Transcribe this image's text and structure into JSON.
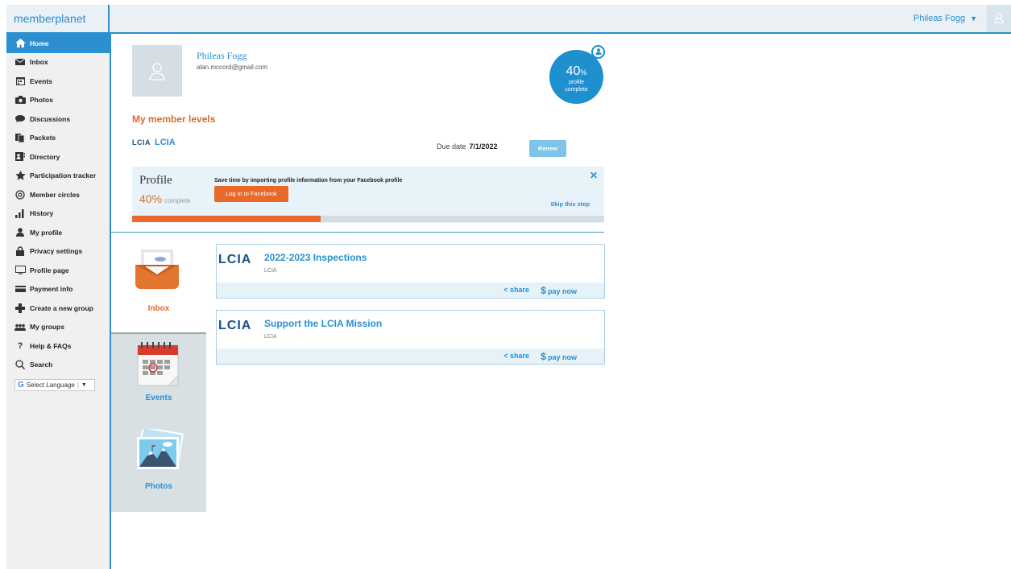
{
  "app": {
    "logo": "memberplanet"
  },
  "header": {
    "user_name": "Phileas Fogg"
  },
  "sidebar": {
    "items": [
      {
        "label": "Home",
        "icon": "home-icon",
        "active": true
      },
      {
        "label": "Inbox",
        "icon": "envelope-icon"
      },
      {
        "label": "Events",
        "icon": "calendar-icon"
      },
      {
        "label": "Photos",
        "icon": "camera-icon"
      },
      {
        "label": "Discussions",
        "icon": "speech-bubble-icon"
      },
      {
        "label": "Packets",
        "icon": "packets-icon"
      },
      {
        "label": "Directory",
        "icon": "directory-icon"
      },
      {
        "label": "Participation tracker",
        "icon": "star-icon"
      },
      {
        "label": "Member circles",
        "icon": "circles-icon"
      },
      {
        "label": "History",
        "icon": "bar-chart-icon"
      },
      {
        "label": "My profile",
        "icon": "person-icon"
      },
      {
        "label": "Privacy settings",
        "icon": "lock-icon"
      },
      {
        "label": "Profile page",
        "icon": "monitor-icon"
      },
      {
        "label": "Payment info",
        "icon": "credit-card-icon"
      },
      {
        "label": "Create a new group",
        "icon": "add-group-icon"
      },
      {
        "label": "My groups",
        "icon": "group-icon"
      },
      {
        "label": "Help & FAQs",
        "icon": "question-icon"
      },
      {
        "label": "Search",
        "icon": "search-icon"
      }
    ],
    "language": "Select Language"
  },
  "profile": {
    "name": "Phileas Fogg",
    "email": "alan.mccord@gmail.com",
    "completion_pct": "40",
    "completion_unit": "%",
    "completion_label_1": "profile",
    "completion_label_2": "complete"
  },
  "levels": {
    "title": "My member levels",
    "items": [
      {
        "logo": "LCIA",
        "name": "LCIA",
        "due_label": "Due date",
        "due_date": "7/1/2022",
        "button": "Renew"
      }
    ]
  },
  "profile_box": {
    "title": "Profile",
    "pct": "40%",
    "pct_label": "complete",
    "prompt": "Save time by importing profile information from your Facebook profile",
    "fb_button": "Log in to Facebook",
    "skip": "Skip this step",
    "progress": 0.4
  },
  "tiles": [
    {
      "label": "Inbox",
      "icon": "inbox-icon"
    },
    {
      "label": "Events",
      "icon": "calendar-icon"
    },
    {
      "label": "Photos",
      "icon": "photos-icon"
    }
  ],
  "inbox_items": [
    {
      "logo": "LCIA",
      "title": "2022-2023 Inspections",
      "org": "LCIA",
      "share": "share",
      "pay": "pay now"
    },
    {
      "logo": "LCIA",
      "title": "Support the LCIA Mission",
      "org": "LCIA",
      "share": "share",
      "pay": "pay now"
    }
  ],
  "colors": {
    "accent": "#2b8fd0",
    "orange": "#e8692a",
    "sidebar_bg": "#f0f0f0"
  }
}
